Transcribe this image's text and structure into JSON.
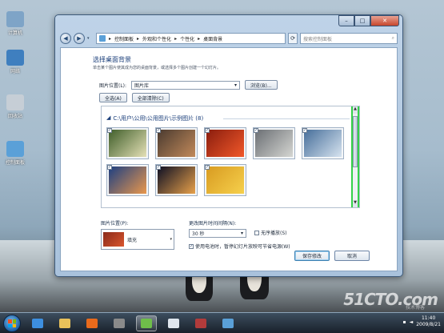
{
  "desktop": {
    "icons": [
      {
        "label": "计算机",
        "color": "#7ea4c7"
      },
      {
        "label": "网络",
        "color": "#3f7fbf"
      },
      {
        "label": "回收站",
        "color": "#c6ced6"
      },
      {
        "label": "控制面板",
        "color": "#5aa0d8"
      }
    ],
    "watermark": "51CTO.com",
    "watermark_sub": "技术博客"
  },
  "window": {
    "caption": {
      "minimize": "–",
      "maximize": "□",
      "close": "✕"
    },
    "nav": {
      "back": "◀",
      "forward": "▶",
      "dropdown": "▾"
    },
    "address": {
      "icon": "control-panel-icon",
      "path": [
        "控制面板",
        "外观和个性化",
        "个性化",
        "桌面背景"
      ],
      "separator": "▸"
    },
    "search": {
      "placeholder": "搜索控制面板"
    },
    "heading": "选择桌面背景",
    "description": "单击某个图片使其成为您的桌面背景，或选择多个图片创建一个幻灯片。",
    "picture_location": {
      "label": "图片位置(L):",
      "value": "图片库",
      "browse": "浏览(B)..."
    },
    "select_all": "全选(A)",
    "clear_all": "全部清除(C)",
    "gallery": {
      "group_title": "C:\\用户\\公用\\公用图片\\示例图片 (8)",
      "thumbs": [
        {
          "name": "flowers",
          "colors": [
            "#3f5e2a",
            "#e4e0b6"
          ]
        },
        {
          "name": "desert",
          "colors": [
            "#4a3a30",
            "#c28a5a"
          ]
        },
        {
          "name": "chrysanthemum",
          "colors": [
            "#8a1d0e",
            "#f1582a"
          ]
        },
        {
          "name": "koala",
          "colors": [
            "#6b6f74",
            "#d5d6d2"
          ]
        },
        {
          "name": "penguins",
          "colors": [
            "#466e9a",
            "#d6e3ef"
          ]
        },
        {
          "name": "lighthouse",
          "colors": [
            "#1c3f82",
            "#e9974c"
          ]
        },
        {
          "name": "jellyfish",
          "colors": [
            "#0c0f24",
            "#e8a14a"
          ]
        },
        {
          "name": "tulips",
          "colors": [
            "#d89b21",
            "#f6d04c"
          ]
        }
      ]
    },
    "picture_position": {
      "label": "图片位置(P):",
      "value": "填充"
    },
    "change_interval": {
      "label": "更改图片时间间隔(N):",
      "value": "30 秒"
    },
    "shuffle": "无序播放(S)",
    "battery": "使用电池时，暂停幻灯片放映可节省电源(W)",
    "save": "保存修改",
    "cancel": "取消"
  },
  "taskbar": {
    "items": [
      {
        "name": "ie-icon",
        "color": "#3d8fe0"
      },
      {
        "name": "explorer-icon",
        "color": "#e8c15a"
      },
      {
        "name": "media-player-icon",
        "color": "#e86a1c"
      },
      {
        "name": "app-icon",
        "color": "#8a8a8a"
      },
      {
        "name": "control-panel-icon",
        "color": "#6fbe4a"
      },
      {
        "name": "notepad-icon",
        "color": "#dfe6ee"
      },
      {
        "name": "window-icon",
        "color": "#b13b3b"
      },
      {
        "name": "network-icon",
        "color": "#5aa0d8"
      }
    ],
    "time": "11:40",
    "date": "2009/8/21"
  }
}
